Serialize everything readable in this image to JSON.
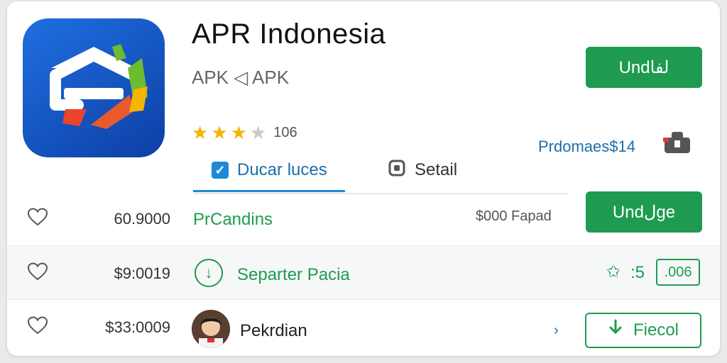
{
  "app": {
    "title": "APR Indonesia",
    "subtitle": "APK ◁ APK",
    "rating_count": "106",
    "rating_value": 3.5,
    "install_label": "Undلفا",
    "promo_text": "Prdomaes$14"
  },
  "tabs": {
    "active_label": "Ducar luces",
    "details_label": "Setail"
  },
  "rows": [
    {
      "price": "60.9000",
      "title": "PrCandins",
      "right_text": "$000 Fapad",
      "button_label": "Undلge"
    },
    {
      "price": "$9:0019",
      "title": "Separter Pacia",
      "star_value": ":5",
      "box_value": ".006"
    },
    {
      "price": "$33:0009",
      "name": "Pekrdian",
      "button_label": "Fiecol"
    }
  ],
  "icons": {
    "heart": "heart-icon",
    "download": "download-icon",
    "star": "star-icon",
    "check": "checkbox-icon",
    "gear": "settings-icon",
    "chevron": "chevron-right-icon"
  },
  "colors": {
    "accent_green": "#1e9b50",
    "accent_blue": "#1d6ea8",
    "star_gold": "#f4b400",
    "icon_blue": "#1f6fe0"
  }
}
